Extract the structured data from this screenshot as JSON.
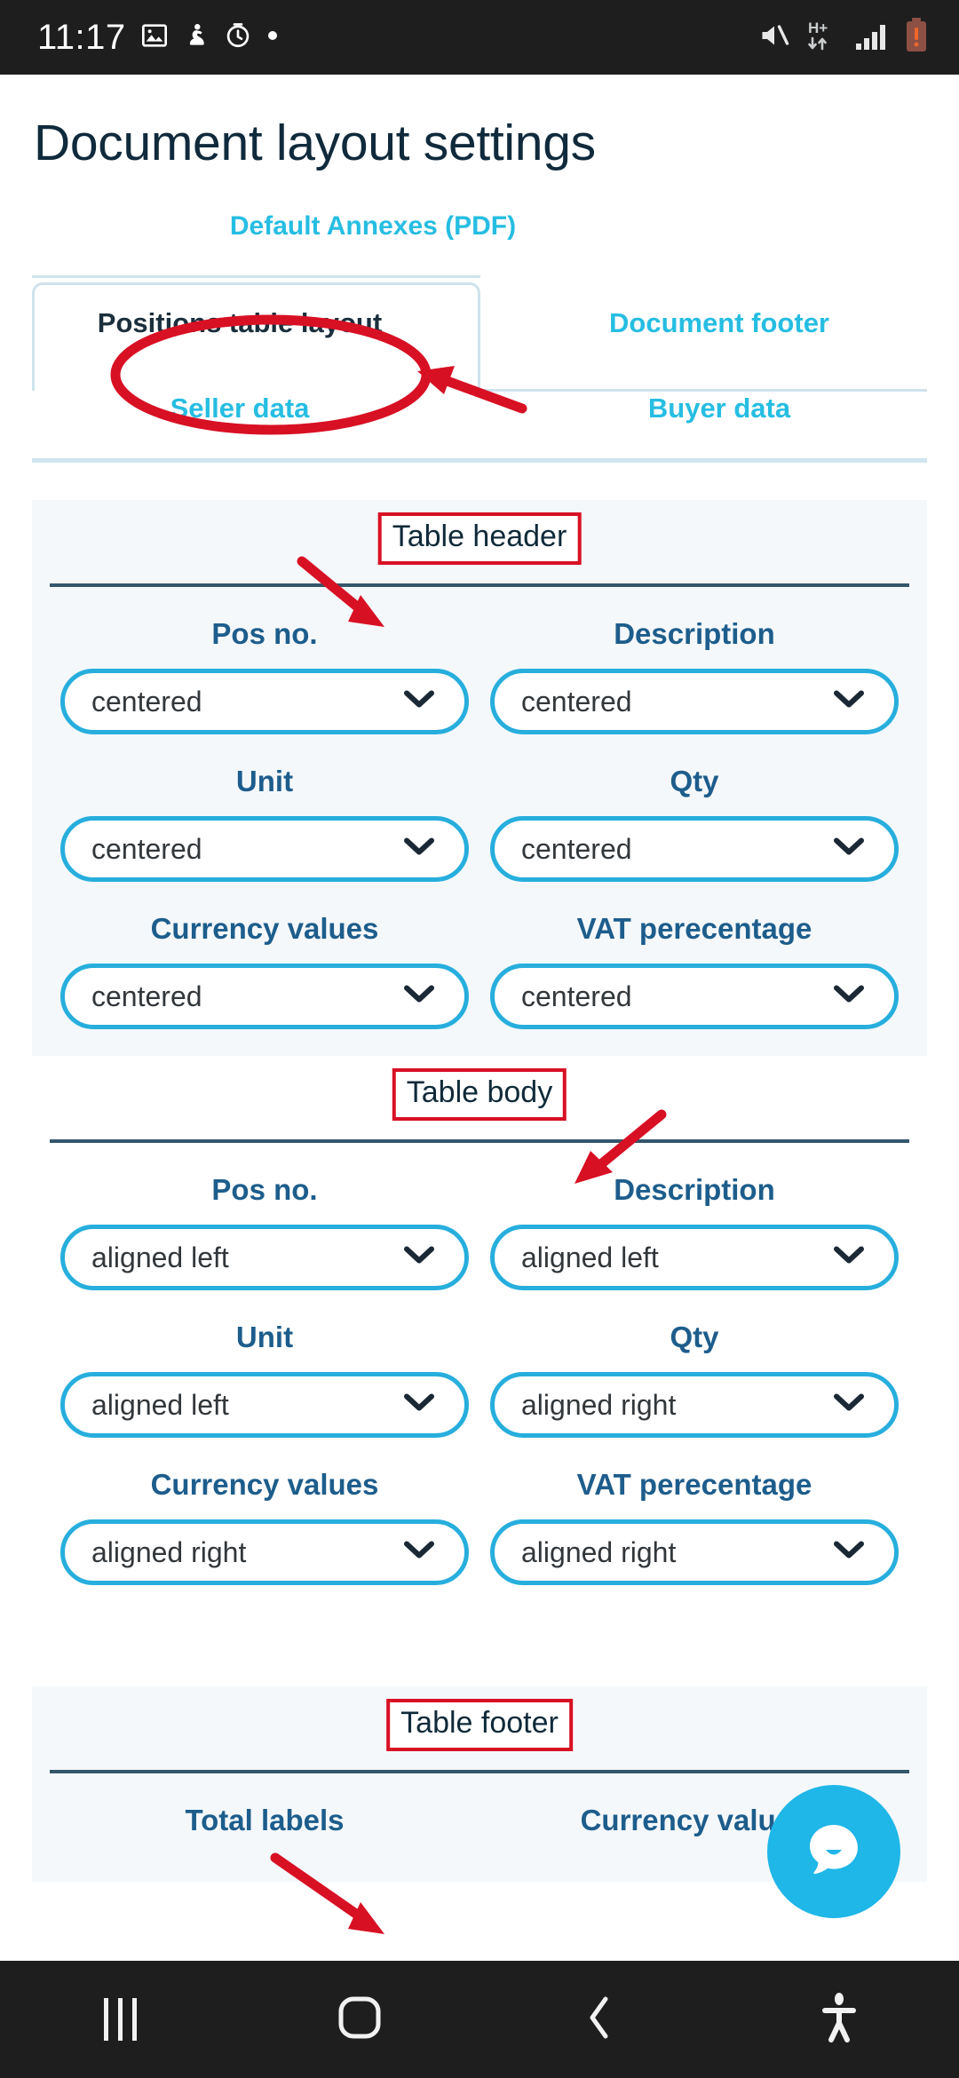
{
  "status_bar": {
    "time": "11:17",
    "left_icons": [
      "image-icon",
      "figure-icon",
      "alarm-icon",
      "dot-icon"
    ],
    "right_icons": [
      "mute-icon",
      "hplus-data-icon",
      "signal-icon",
      "battery-warning-icon"
    ],
    "network_label": "H+",
    "background": "#1e1e1e"
  },
  "header": {
    "title": "Document layout settings",
    "annex_link": "Default Annexes (PDF)"
  },
  "tabs": {
    "row1": [
      {
        "label": "Positions table layout",
        "active": true
      },
      {
        "label": "Document footer",
        "active": false
      }
    ],
    "row2": [
      {
        "label": "Seller data",
        "active": false
      },
      {
        "label": "Buyer data",
        "active": false
      }
    ],
    "active_color": "#1b2f3d",
    "inactive_color": "#26bde2"
  },
  "sections": [
    {
      "title": "Table header",
      "tinted": true,
      "fields": [
        {
          "label": "Pos no.",
          "value": "centered"
        },
        {
          "label": "Description",
          "value": "centered"
        },
        {
          "label": "Unit",
          "value": "centered"
        },
        {
          "label": "Qty",
          "value": "centered"
        },
        {
          "label": "Currency values",
          "value": "centered"
        },
        {
          "label": "VAT perecentage",
          "value": "centered"
        }
      ]
    },
    {
      "title": "Table body",
      "tinted": false,
      "fields": [
        {
          "label": "Pos no.",
          "value": "aligned left"
        },
        {
          "label": "Description",
          "value": "aligned left"
        },
        {
          "label": "Unit",
          "value": "aligned left"
        },
        {
          "label": "Qty",
          "value": "aligned right"
        },
        {
          "label": "Currency values",
          "value": "aligned right"
        },
        {
          "label": "VAT perecentage",
          "value": "aligned right"
        }
      ]
    },
    {
      "title": "Table footer",
      "tinted": true,
      "fields": [
        {
          "label": "Total labels",
          "value": ""
        },
        {
          "label": "Currency values",
          "value": ""
        }
      ]
    }
  ],
  "annotations": {
    "ellipse_target": "Positions table layout",
    "arrow_targets": [
      "Positions table layout",
      "Table header",
      "Table body",
      "Table footer"
    ],
    "color": "#d81024"
  },
  "chat_button": {
    "icon": "chat-bubble-icon",
    "color": "#1fb6e8"
  },
  "nav_bar": {
    "buttons": [
      "recents-icon",
      "home-icon",
      "back-icon",
      "accessibility-icon"
    ],
    "background": "#1e1e1e"
  },
  "theme": {
    "accent_cyan": "#27aedd",
    "link_cyan": "#26bde2",
    "label_blue": "#1d5d8c",
    "title_dark": "#102a3c",
    "panel_tint": "#f4f8fb",
    "rule_dark": "#34566b",
    "tab_border": "#cfe3ee"
  }
}
